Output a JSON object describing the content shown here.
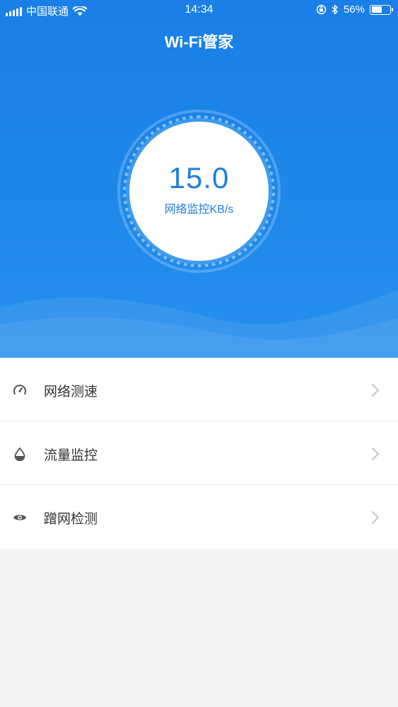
{
  "status_bar": {
    "carrier": "中国联通",
    "time": "14:34",
    "battery_percent": "56%",
    "battery_level": 0.56
  },
  "header": {
    "title": "Wi-Fi管家"
  },
  "gauge": {
    "value": "15.0",
    "label": "网络监控KB/s"
  },
  "menu": {
    "items": [
      {
        "label": "网络测速",
        "icon": "speedometer-icon"
      },
      {
        "label": "流量监控",
        "icon": "water-drop-icon"
      },
      {
        "label": "蹭网检测",
        "icon": "eye-icon"
      }
    ]
  },
  "colors": {
    "primary_blue": "#1e88ea",
    "accent_text": "#1d7ee0",
    "page_bg": "#f4f4f4"
  }
}
